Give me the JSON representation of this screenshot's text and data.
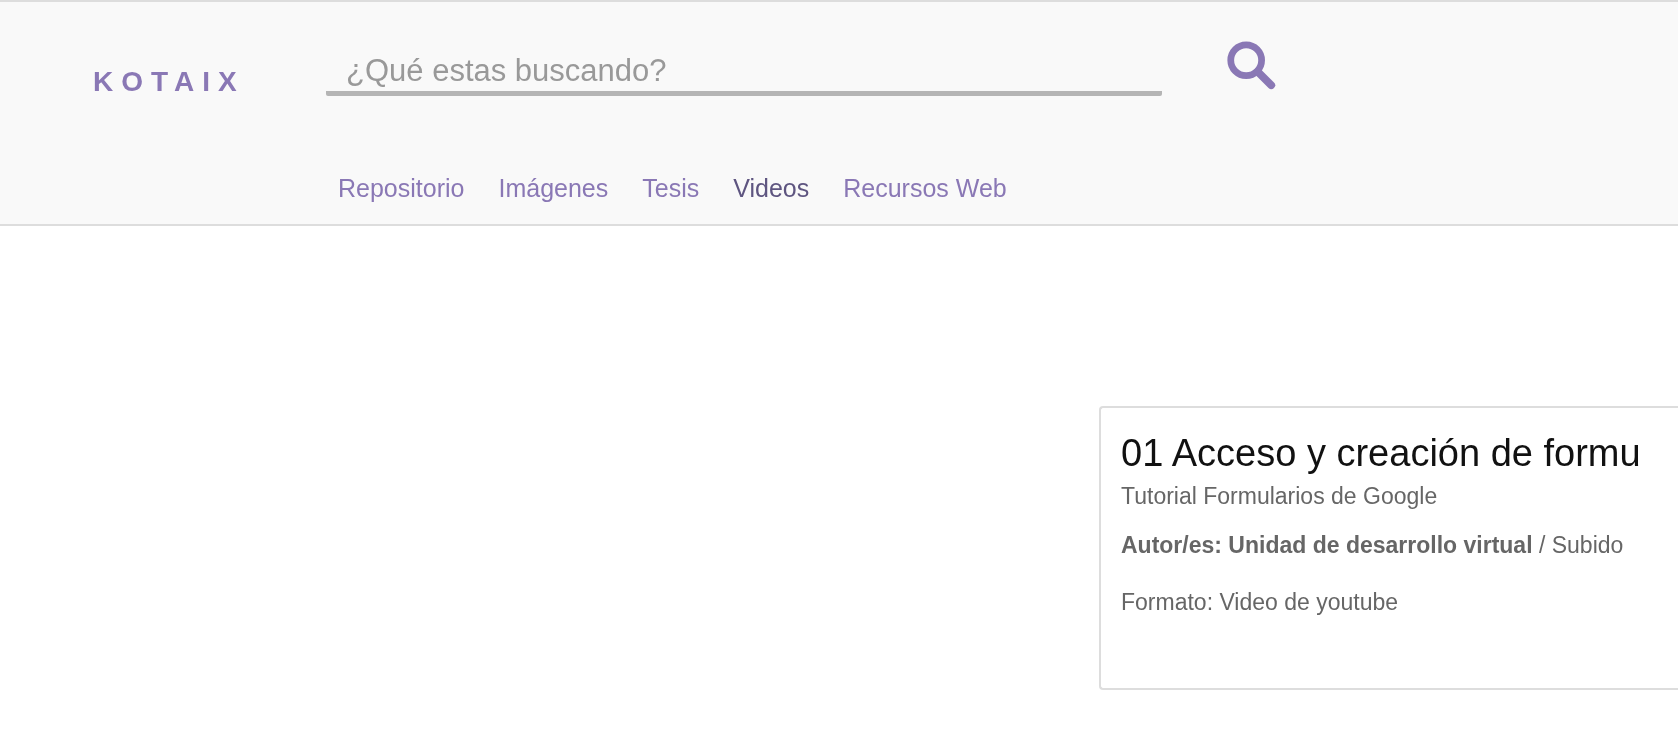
{
  "logo": "KOTAIX",
  "search": {
    "placeholder": "¿Qué estas buscando?"
  },
  "tabs": [
    {
      "label": "Repositorio",
      "selected": false
    },
    {
      "label": "Imágenes",
      "selected": false
    },
    {
      "label": "Tesis",
      "selected": false
    },
    {
      "label": "Videos",
      "selected": true
    },
    {
      "label": "Recursos Web",
      "selected": false
    }
  ],
  "result": {
    "title": "01 Acceso y creación de formu",
    "subtitle": "Tutorial Formularios de Google",
    "authors": "**Autor/es: Unidad de desarrollo virtual** / Subido",
    "format": "Formato: Video de youtube"
  }
}
